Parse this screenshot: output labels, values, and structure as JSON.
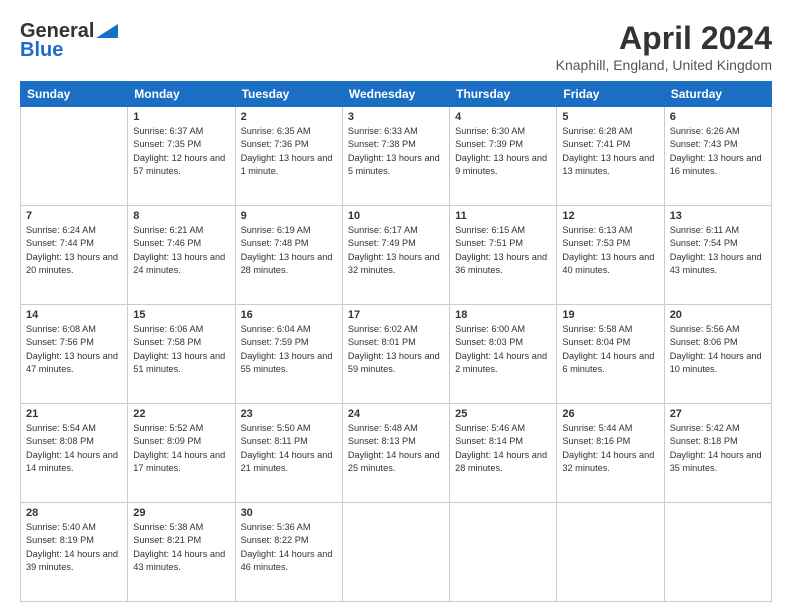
{
  "header": {
    "logo_general": "General",
    "logo_blue": "Blue",
    "month_year": "April 2024",
    "location": "Knaphill, England, United Kingdom"
  },
  "days_of_week": [
    "Sunday",
    "Monday",
    "Tuesday",
    "Wednesday",
    "Thursday",
    "Friday",
    "Saturday"
  ],
  "weeks": [
    [
      {
        "day": "",
        "sunrise": "",
        "sunset": "",
        "daylight": ""
      },
      {
        "day": "1",
        "sunrise": "Sunrise: 6:37 AM",
        "sunset": "Sunset: 7:35 PM",
        "daylight": "Daylight: 12 hours and 57 minutes."
      },
      {
        "day": "2",
        "sunrise": "Sunrise: 6:35 AM",
        "sunset": "Sunset: 7:36 PM",
        "daylight": "Daylight: 13 hours and 1 minute."
      },
      {
        "day": "3",
        "sunrise": "Sunrise: 6:33 AM",
        "sunset": "Sunset: 7:38 PM",
        "daylight": "Daylight: 13 hours and 5 minutes."
      },
      {
        "day": "4",
        "sunrise": "Sunrise: 6:30 AM",
        "sunset": "Sunset: 7:39 PM",
        "daylight": "Daylight: 13 hours and 9 minutes."
      },
      {
        "day": "5",
        "sunrise": "Sunrise: 6:28 AM",
        "sunset": "Sunset: 7:41 PM",
        "daylight": "Daylight: 13 hours and 13 minutes."
      },
      {
        "day": "6",
        "sunrise": "Sunrise: 6:26 AM",
        "sunset": "Sunset: 7:43 PM",
        "daylight": "Daylight: 13 hours and 16 minutes."
      }
    ],
    [
      {
        "day": "7",
        "sunrise": "Sunrise: 6:24 AM",
        "sunset": "Sunset: 7:44 PM",
        "daylight": "Daylight: 13 hours and 20 minutes."
      },
      {
        "day": "8",
        "sunrise": "Sunrise: 6:21 AM",
        "sunset": "Sunset: 7:46 PM",
        "daylight": "Daylight: 13 hours and 24 minutes."
      },
      {
        "day": "9",
        "sunrise": "Sunrise: 6:19 AM",
        "sunset": "Sunset: 7:48 PM",
        "daylight": "Daylight: 13 hours and 28 minutes."
      },
      {
        "day": "10",
        "sunrise": "Sunrise: 6:17 AM",
        "sunset": "Sunset: 7:49 PM",
        "daylight": "Daylight: 13 hours and 32 minutes."
      },
      {
        "day": "11",
        "sunrise": "Sunrise: 6:15 AM",
        "sunset": "Sunset: 7:51 PM",
        "daylight": "Daylight: 13 hours and 36 minutes."
      },
      {
        "day": "12",
        "sunrise": "Sunrise: 6:13 AM",
        "sunset": "Sunset: 7:53 PM",
        "daylight": "Daylight: 13 hours and 40 minutes."
      },
      {
        "day": "13",
        "sunrise": "Sunrise: 6:11 AM",
        "sunset": "Sunset: 7:54 PM",
        "daylight": "Daylight: 13 hours and 43 minutes."
      }
    ],
    [
      {
        "day": "14",
        "sunrise": "Sunrise: 6:08 AM",
        "sunset": "Sunset: 7:56 PM",
        "daylight": "Daylight: 13 hours and 47 minutes."
      },
      {
        "day": "15",
        "sunrise": "Sunrise: 6:06 AM",
        "sunset": "Sunset: 7:58 PM",
        "daylight": "Daylight: 13 hours and 51 minutes."
      },
      {
        "day": "16",
        "sunrise": "Sunrise: 6:04 AM",
        "sunset": "Sunset: 7:59 PM",
        "daylight": "Daylight: 13 hours and 55 minutes."
      },
      {
        "day": "17",
        "sunrise": "Sunrise: 6:02 AM",
        "sunset": "Sunset: 8:01 PM",
        "daylight": "Daylight: 13 hours and 59 minutes."
      },
      {
        "day": "18",
        "sunrise": "Sunrise: 6:00 AM",
        "sunset": "Sunset: 8:03 PM",
        "daylight": "Daylight: 14 hours and 2 minutes."
      },
      {
        "day": "19",
        "sunrise": "Sunrise: 5:58 AM",
        "sunset": "Sunset: 8:04 PM",
        "daylight": "Daylight: 14 hours and 6 minutes."
      },
      {
        "day": "20",
        "sunrise": "Sunrise: 5:56 AM",
        "sunset": "Sunset: 8:06 PM",
        "daylight": "Daylight: 14 hours and 10 minutes."
      }
    ],
    [
      {
        "day": "21",
        "sunrise": "Sunrise: 5:54 AM",
        "sunset": "Sunset: 8:08 PM",
        "daylight": "Daylight: 14 hours and 14 minutes."
      },
      {
        "day": "22",
        "sunrise": "Sunrise: 5:52 AM",
        "sunset": "Sunset: 8:09 PM",
        "daylight": "Daylight: 14 hours and 17 minutes."
      },
      {
        "day": "23",
        "sunrise": "Sunrise: 5:50 AM",
        "sunset": "Sunset: 8:11 PM",
        "daylight": "Daylight: 14 hours and 21 minutes."
      },
      {
        "day": "24",
        "sunrise": "Sunrise: 5:48 AM",
        "sunset": "Sunset: 8:13 PM",
        "daylight": "Daylight: 14 hours and 25 minutes."
      },
      {
        "day": "25",
        "sunrise": "Sunrise: 5:46 AM",
        "sunset": "Sunset: 8:14 PM",
        "daylight": "Daylight: 14 hours and 28 minutes."
      },
      {
        "day": "26",
        "sunrise": "Sunrise: 5:44 AM",
        "sunset": "Sunset: 8:16 PM",
        "daylight": "Daylight: 14 hours and 32 minutes."
      },
      {
        "day": "27",
        "sunrise": "Sunrise: 5:42 AM",
        "sunset": "Sunset: 8:18 PM",
        "daylight": "Daylight: 14 hours and 35 minutes."
      }
    ],
    [
      {
        "day": "28",
        "sunrise": "Sunrise: 5:40 AM",
        "sunset": "Sunset: 8:19 PM",
        "daylight": "Daylight: 14 hours and 39 minutes."
      },
      {
        "day": "29",
        "sunrise": "Sunrise: 5:38 AM",
        "sunset": "Sunset: 8:21 PM",
        "daylight": "Daylight: 14 hours and 43 minutes."
      },
      {
        "day": "30",
        "sunrise": "Sunrise: 5:36 AM",
        "sunset": "Sunset: 8:22 PM",
        "daylight": "Daylight: 14 hours and 46 minutes."
      },
      {
        "day": "",
        "sunrise": "",
        "sunset": "",
        "daylight": ""
      },
      {
        "day": "",
        "sunrise": "",
        "sunset": "",
        "daylight": ""
      },
      {
        "day": "",
        "sunrise": "",
        "sunset": "",
        "daylight": ""
      },
      {
        "day": "",
        "sunrise": "",
        "sunset": "",
        "daylight": ""
      }
    ]
  ]
}
